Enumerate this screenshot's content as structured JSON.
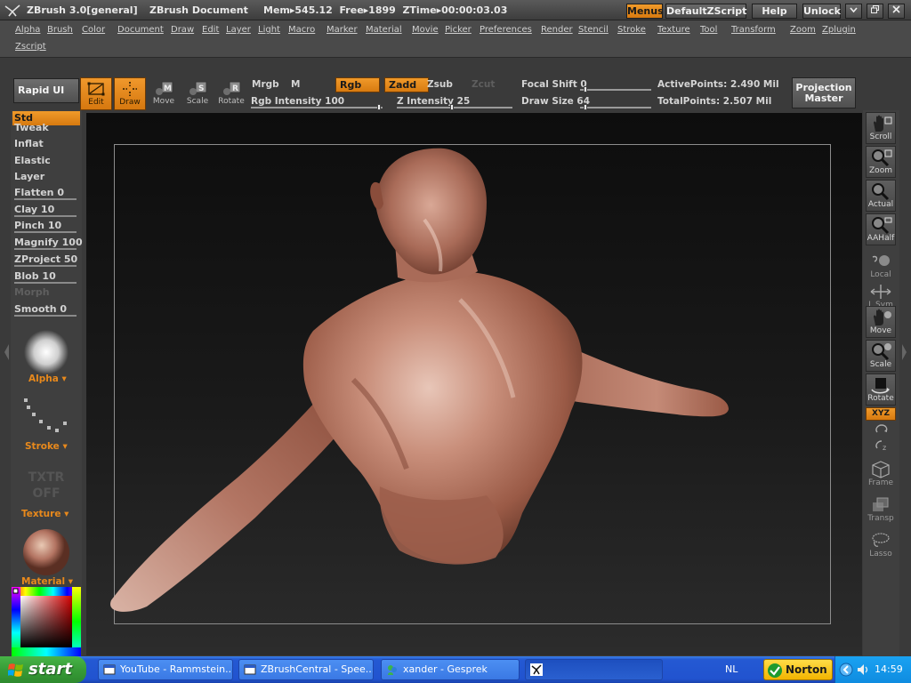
{
  "titlebar": {
    "app": "ZBrush 3.0[general]",
    "document": "ZBrush Document",
    "mem": "Mem▸545.12  Free▸1899  ZTime▸00:00:03.03",
    "buttons": {
      "menus": "Menus",
      "script": "DefaultZScript",
      "help": "Help",
      "unlock": "Unlock"
    }
  },
  "menubar": {
    "items": [
      "Alpha",
      "Brush",
      "Color",
      "Document",
      "Draw",
      "Edit",
      "Layer",
      "Light",
      "Macro",
      "Marker",
      "Material",
      "Movie",
      "Picker",
      "Preferences",
      "Render",
      "Stencil",
      "Stroke",
      "Texture",
      "Tool",
      "Transform",
      "Zoom",
      "Zplugin",
      "Zscript"
    ]
  },
  "toolbar": {
    "rapid_ui": "Rapid UI",
    "tools": [
      {
        "label": "Edit",
        "active": true,
        "icon": "edit-icon"
      },
      {
        "label": "Draw",
        "active": true,
        "icon": "draw-icon"
      },
      {
        "label": "Move",
        "active": false,
        "icon": "move-icon"
      },
      {
        "label": "Scale",
        "active": false,
        "icon": "scale-icon"
      },
      {
        "label": "Rotate",
        "active": false,
        "icon": "rotate-icon"
      }
    ],
    "mrgb": "Mrgb",
    "m": "M",
    "rgb": "Rgb",
    "zadd": "Zadd",
    "zsub": "Zsub",
    "zcut": "Zcut",
    "rgb_intensity": "Rgb  Intensity 100",
    "z_intensity": "Z  Intensity 25",
    "focal_shift": "Focal  Shift 0",
    "draw_size": "Draw  Size 64",
    "active_points": "ActivePoints: 2.490  Mil",
    "total_points": "TotalPoints: 2.507  Mil",
    "projection_master_1": "Projection",
    "projection_master_2": "Master"
  },
  "brushes": {
    "items": [
      {
        "label": "Std",
        "selected": true
      },
      {
        "label": "Tweak",
        "selected": false
      },
      {
        "label": "Inflat",
        "selected": false
      },
      {
        "label": "Elastic",
        "selected": false
      },
      {
        "label": "Layer",
        "selected": false
      },
      {
        "label": "Flatten 0",
        "slider": true
      },
      {
        "label": "Clay 10",
        "slider": true
      },
      {
        "label": "Pinch 10",
        "slider": true
      },
      {
        "label": "Magnify 100",
        "slider": true
      },
      {
        "label": "ZProject 50",
        "slider": true
      },
      {
        "label": "Blob 10",
        "slider": true
      },
      {
        "label": "Morph",
        "dim": true
      },
      {
        "label": "Smooth 0",
        "slider": true
      }
    ],
    "alpha_label": "Alpha",
    "stroke_label": "Stroke",
    "txtr_off_1": "TXTR",
    "txtr_off_2": "OFF",
    "texture_label": "Texture",
    "material_label": "Material"
  },
  "right_tools": {
    "items": [
      "Scroll",
      "Zoom",
      "Actual",
      "AAHalf",
      "Local",
      "L.Sym",
      "Move",
      "Scale",
      "Rotate",
      "XYZ",
      "Frame",
      "Transp",
      "Lasso"
    ]
  },
  "taskbar": {
    "start": "start",
    "tasks": [
      "YouTube - Rammstein...",
      "ZBrushCentral - Spee...",
      "xander - Gesprek",
      ""
    ],
    "lang": "NL",
    "norton": "Norton",
    "clock": "14:59"
  },
  "colors": {
    "accent_orange": "#e8891c",
    "sculpt_clay": "#b37462",
    "taskbar_blue": "#2459d3",
    "start_green": "#379c37"
  }
}
